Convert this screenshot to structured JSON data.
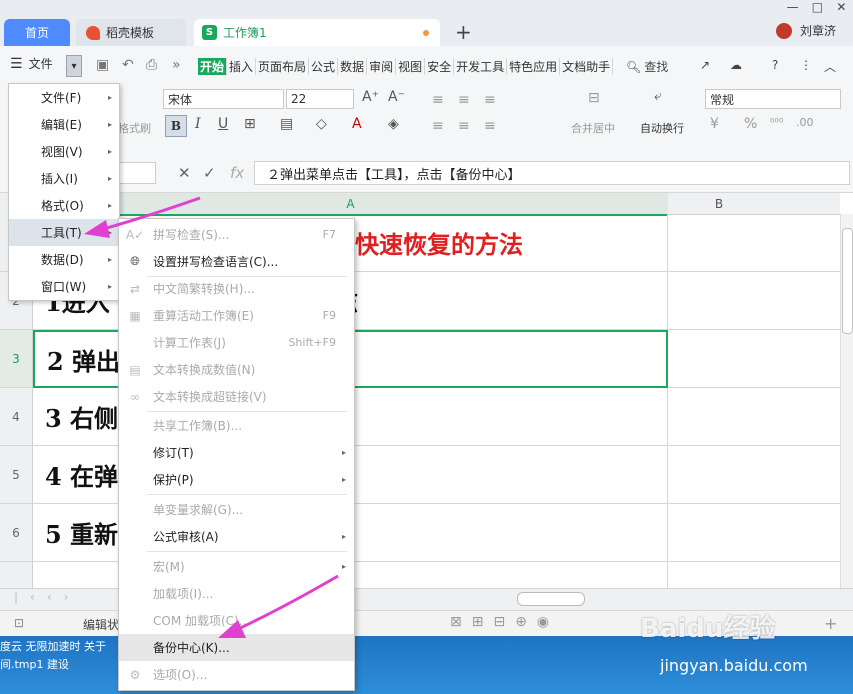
{
  "tabs": {
    "home": "首页",
    "template": "稻壳模板",
    "workbook": "工作簿1",
    "user": "刘章济"
  },
  "menubar": {
    "file": "文件",
    "ribbon_tabs": [
      "开始",
      "插入",
      "页面布局",
      "公式",
      "数据",
      "审阅",
      "视图",
      "安全",
      "开发工具",
      "特色应用",
      "文档助手"
    ],
    "search": "查找"
  },
  "ribbon": {
    "font_name": "宋体",
    "font_size": "22",
    "format_brush": "格式刷",
    "merge_center": "合并居中",
    "wrap_text": "自动换行",
    "number_format": "常规"
  },
  "formula_bar": {
    "content": "２弹出菜单点击【工具】，点击【备份中心】"
  },
  "grid": {
    "columns": [
      "A",
      "B"
    ],
    "rows": [
      {
        "num": "1",
        "text": "快速恢复的方法"
      },
      {
        "num": "2",
        "text": "1进入              击左上方倒尖角的标志"
      },
      {
        "num": "3",
        "text": "2 弹出              ，点击【备份中心】"
      },
      {
        "num": "4",
        "text": "3 右侧              【查看其他备份管理】"
      },
      {
        "num": "5",
        "text": "4 在弹              的文件，点击进入，"
      },
      {
        "num": "6",
        "text": "5 重新"
      }
    ]
  },
  "file_menu": [
    {
      "label": "文件(F)"
    },
    {
      "label": "编辑(E)"
    },
    {
      "label": "视图(V)"
    },
    {
      "label": "插入(I)"
    },
    {
      "label": "格式(O)"
    },
    {
      "label": "工具(T)"
    },
    {
      "label": "数据(D)"
    },
    {
      "label": "窗口(W)"
    }
  ],
  "tools_menu": [
    {
      "label": "拼写检查(S)...",
      "shortcut": "F7",
      "disabled": true,
      "icon": "spellcheck-icon"
    },
    {
      "label": "设置拼写检查语言(C)...",
      "shortcut": "",
      "disabled": false,
      "icon": "language-icon"
    },
    {
      "label": "中文简繁转换(H)...",
      "shortcut": "",
      "disabled": true,
      "icon": "convert-icon"
    },
    {
      "label": "重算活动工作簿(E)",
      "shortcut": "F9",
      "disabled": true,
      "icon": "recalc-icon"
    },
    {
      "label": "计算工作表(J)",
      "shortcut": "Shift+F9",
      "disabled": true,
      "icon": ""
    },
    {
      "label": "文本转换成数值(N)",
      "shortcut": "",
      "disabled": true,
      "icon": "text-number-icon"
    },
    {
      "label": "文本转换成超链接(V)",
      "shortcut": "",
      "disabled": true,
      "icon": "link-icon"
    },
    {
      "label": "共享工作簿(B)...",
      "shortcut": "",
      "disabled": true,
      "icon": ""
    },
    {
      "label": "修订(T)",
      "shortcut": "",
      "disabled": false,
      "icon": "",
      "submenu": true
    },
    {
      "label": "保护(P)",
      "shortcut": "",
      "disabled": false,
      "icon": "",
      "submenu": true
    },
    {
      "label": "单变量求解(G)...",
      "shortcut": "",
      "disabled": true,
      "icon": ""
    },
    {
      "label": "公式审核(A)",
      "shortcut": "",
      "disabled": false,
      "icon": "",
      "submenu": true
    },
    {
      "label": "宏(M)",
      "shortcut": "",
      "disabled": true,
      "icon": "",
      "submenu": true
    },
    {
      "label": "加载项(I)...",
      "shortcut": "",
      "disabled": true,
      "icon": ""
    },
    {
      "label": "COM 加载项(C)...",
      "shortcut": "",
      "disabled": true,
      "icon": ""
    },
    {
      "label": "备份中心(K)...",
      "shortcut": "",
      "disabled": false,
      "icon": ""
    },
    {
      "label": "选项(O)...",
      "shortcut": "",
      "disabled": true,
      "icon": "gear-icon"
    }
  ],
  "statusbar": {
    "mode": "编辑状"
  },
  "taskbar": {
    "line1": "度云  无限加速时  关于",
    "line2": "间.tmp1      建设"
  },
  "watermark": {
    "logo": "Baidu经验",
    "url": "jingyan.baidu.com"
  },
  "colors": {
    "accent_green": "#1aa85f",
    "title_red": "#e02020",
    "arrow_magenta": "#e040d0",
    "home_tab_blue": "#4f8bff"
  }
}
